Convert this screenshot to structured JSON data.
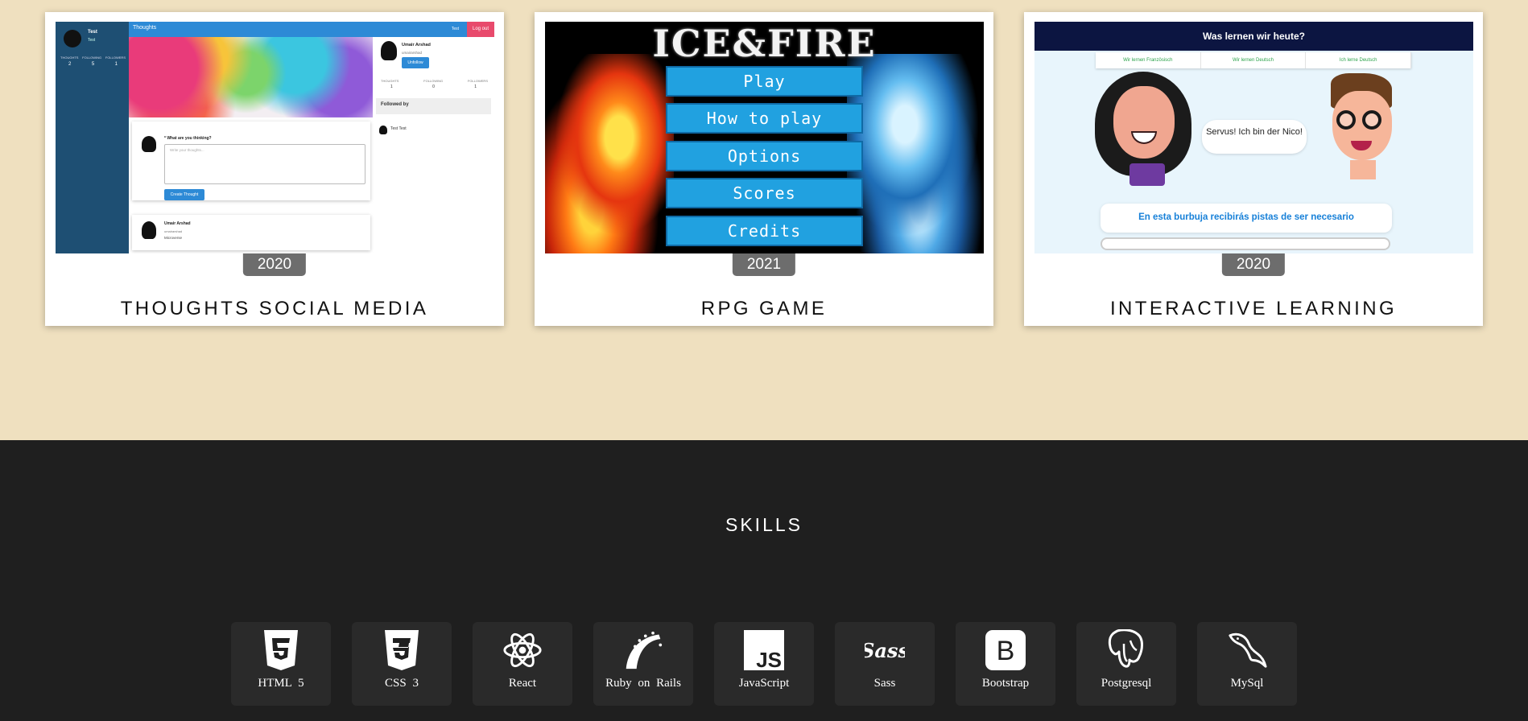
{
  "projects": [
    {
      "year": "2020",
      "title": "THOUGHTS SOCIAL MEDIA",
      "screenshot": {
        "app_title": "Thoughts",
        "user_name": "Test",
        "user_handle": "Test",
        "stats_labels": [
          "THOUGHTS",
          "FOLLOWING",
          "FOLLOWERS"
        ],
        "stats_values": [
          "2",
          "5",
          "1"
        ],
        "topbar_user": "Test",
        "logout": "Log out",
        "prompt": "* What are you thinking?",
        "placeholder": "Write your thoughts...",
        "create_button": "Create Thought",
        "post_author": "Umair Arshad",
        "post_handle": "umairarshad",
        "post_text": "Microverse",
        "profile_name": "Umair Arshad",
        "profile_handle": "umairarshad",
        "unfollow": "Unfollow",
        "profile_stats_labels": [
          "THOUGHTS",
          "FOLLOWING",
          "FOLLOWERS"
        ],
        "profile_stats_values": [
          "1",
          "0",
          "1"
        ],
        "followed_by": "Followed by",
        "follower": "Test Test"
      }
    },
    {
      "year": "2021",
      "title": "RPG GAME",
      "screenshot": {
        "logo": "ICE&FIRE",
        "menu": [
          "Play",
          "How to play",
          "Options",
          "Scores",
          "Credits"
        ]
      }
    },
    {
      "year": "2020",
      "title": "INTERACTIVE LEARNING",
      "screenshot": {
        "header": "Was lernen wir heute?",
        "tabs": [
          "Wir lernen Französisch",
          "Wir lernen Deutsch",
          "Ich lerne Deutsch"
        ],
        "speech": "Servus! Ich bin der Nico!",
        "hint": "En esta burbuja recibirás pistas de ser necesario"
      }
    }
  ],
  "skills": {
    "heading": "SKILLS",
    "items": [
      {
        "label": "HTML 5",
        "icon": "html5-icon"
      },
      {
        "label": "CSS 3",
        "icon": "css3-icon"
      },
      {
        "label": "React",
        "icon": "react-icon"
      },
      {
        "label": "Ruby on Rails",
        "icon": "rails-icon"
      },
      {
        "label": "JavaScript",
        "icon": "javascript-icon"
      },
      {
        "label": "Sass",
        "icon": "sass-icon"
      },
      {
        "label": "Bootstrap",
        "icon": "bootstrap-icon"
      },
      {
        "label": "Postgresql",
        "icon": "postgresql-icon"
      },
      {
        "label": "MySql",
        "icon": "mysql-icon"
      }
    ]
  },
  "colors": {
    "portfolio_bg": "#efe0bf",
    "skills_bg": "#1f1f1f",
    "skill_card": "#2a2a2a",
    "year_badge": "#6d6d6d"
  }
}
